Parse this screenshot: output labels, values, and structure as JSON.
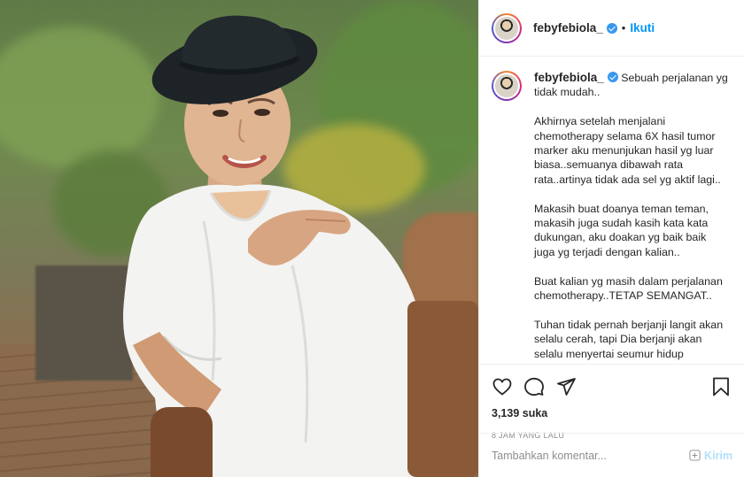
{
  "header": {
    "username": "febyfebiola_",
    "separator": "•",
    "follow_label": "Ikuti"
  },
  "caption": {
    "username": "febyfebiola_",
    "paragraphs": [
      "Sebuah perjalanan yg tidak mudah..",
      "Akhirnya setelah menjalani chemotherapy selama 6X hasil tumor marker aku menunjukan hasil yg luar biasa..semuanya dibawah rata rata..artinya tidak ada sel yg aktif lagi..",
      "Makasih buat doanya teman teman, makasih juga sudah kasih kata kata dukungan, aku doakan yg baik baik juga yg terjadi dengan kalian..",
      "Buat kalian yg masih dalam perjalanan chemotherapy..TETAP SEMANGAT..",
      "Tuhan tidak pernah berjanji langit akan selalu cerah, tapi Dia berjanji akan selalu menyertai seumur hidup"
    ]
  },
  "icons": {
    "like": "heart-icon",
    "comment": "comment-icon",
    "share": "paper-plane-icon",
    "save": "bookmark-icon",
    "emoji": "emoji-icon"
  },
  "stats": {
    "likes": "3,139 suka",
    "time": "8 JAM YANG LALU"
  },
  "comment_box": {
    "placeholder": "Tambahkan komentar...",
    "post_label": "Kirim"
  },
  "colors": {
    "accent": "#0095f6",
    "verified": "#3897f0",
    "post_disabled": "#b2dffc",
    "muted": "#8e8e8e"
  }
}
